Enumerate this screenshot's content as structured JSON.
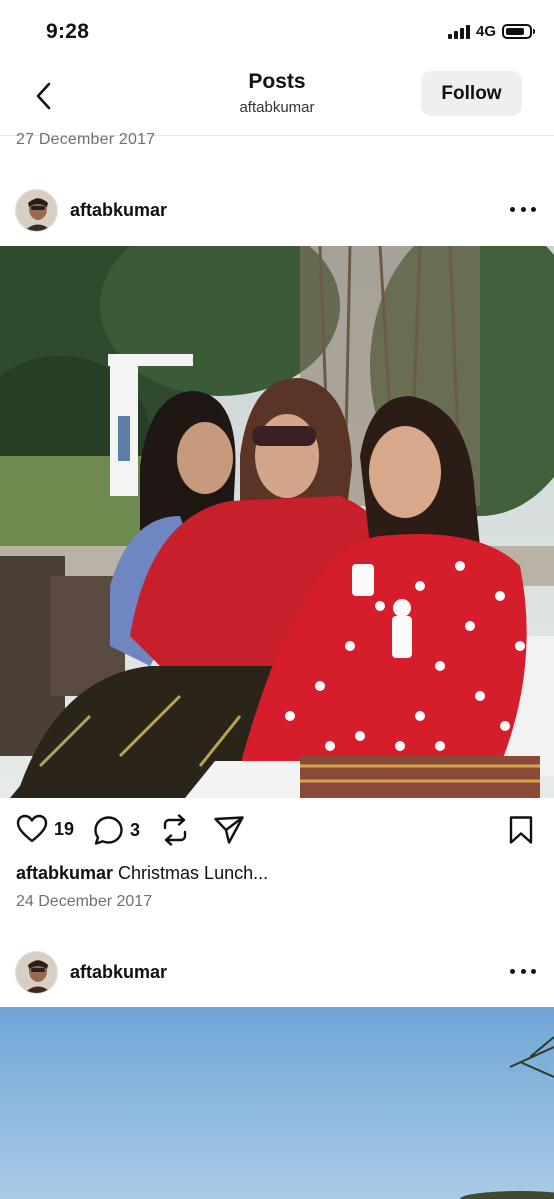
{
  "status_bar": {
    "time": "9:28",
    "network": "4G",
    "battery_level": 0.8
  },
  "header": {
    "title": "Posts",
    "subtitle": "aftabkumar",
    "back_icon": "chevron-left-icon",
    "follow_label": "Follow"
  },
  "previous_post": {
    "date": "27 December 2017"
  },
  "posts": [
    {
      "username": "aftabkumar",
      "more_icon": "more-horizontal-icon",
      "likes": "19",
      "comments": "3",
      "caption_user": "aftabkumar",
      "caption_text": "Christmas Lunch...",
      "date": "24 December 2017"
    },
    {
      "username": "aftabkumar",
      "more_icon": "more-horizontal-icon"
    }
  ],
  "icons": {
    "like": "heart-icon",
    "comment": "comment-icon",
    "repost": "repost-icon",
    "share": "send-icon",
    "save": "bookmark-icon"
  }
}
